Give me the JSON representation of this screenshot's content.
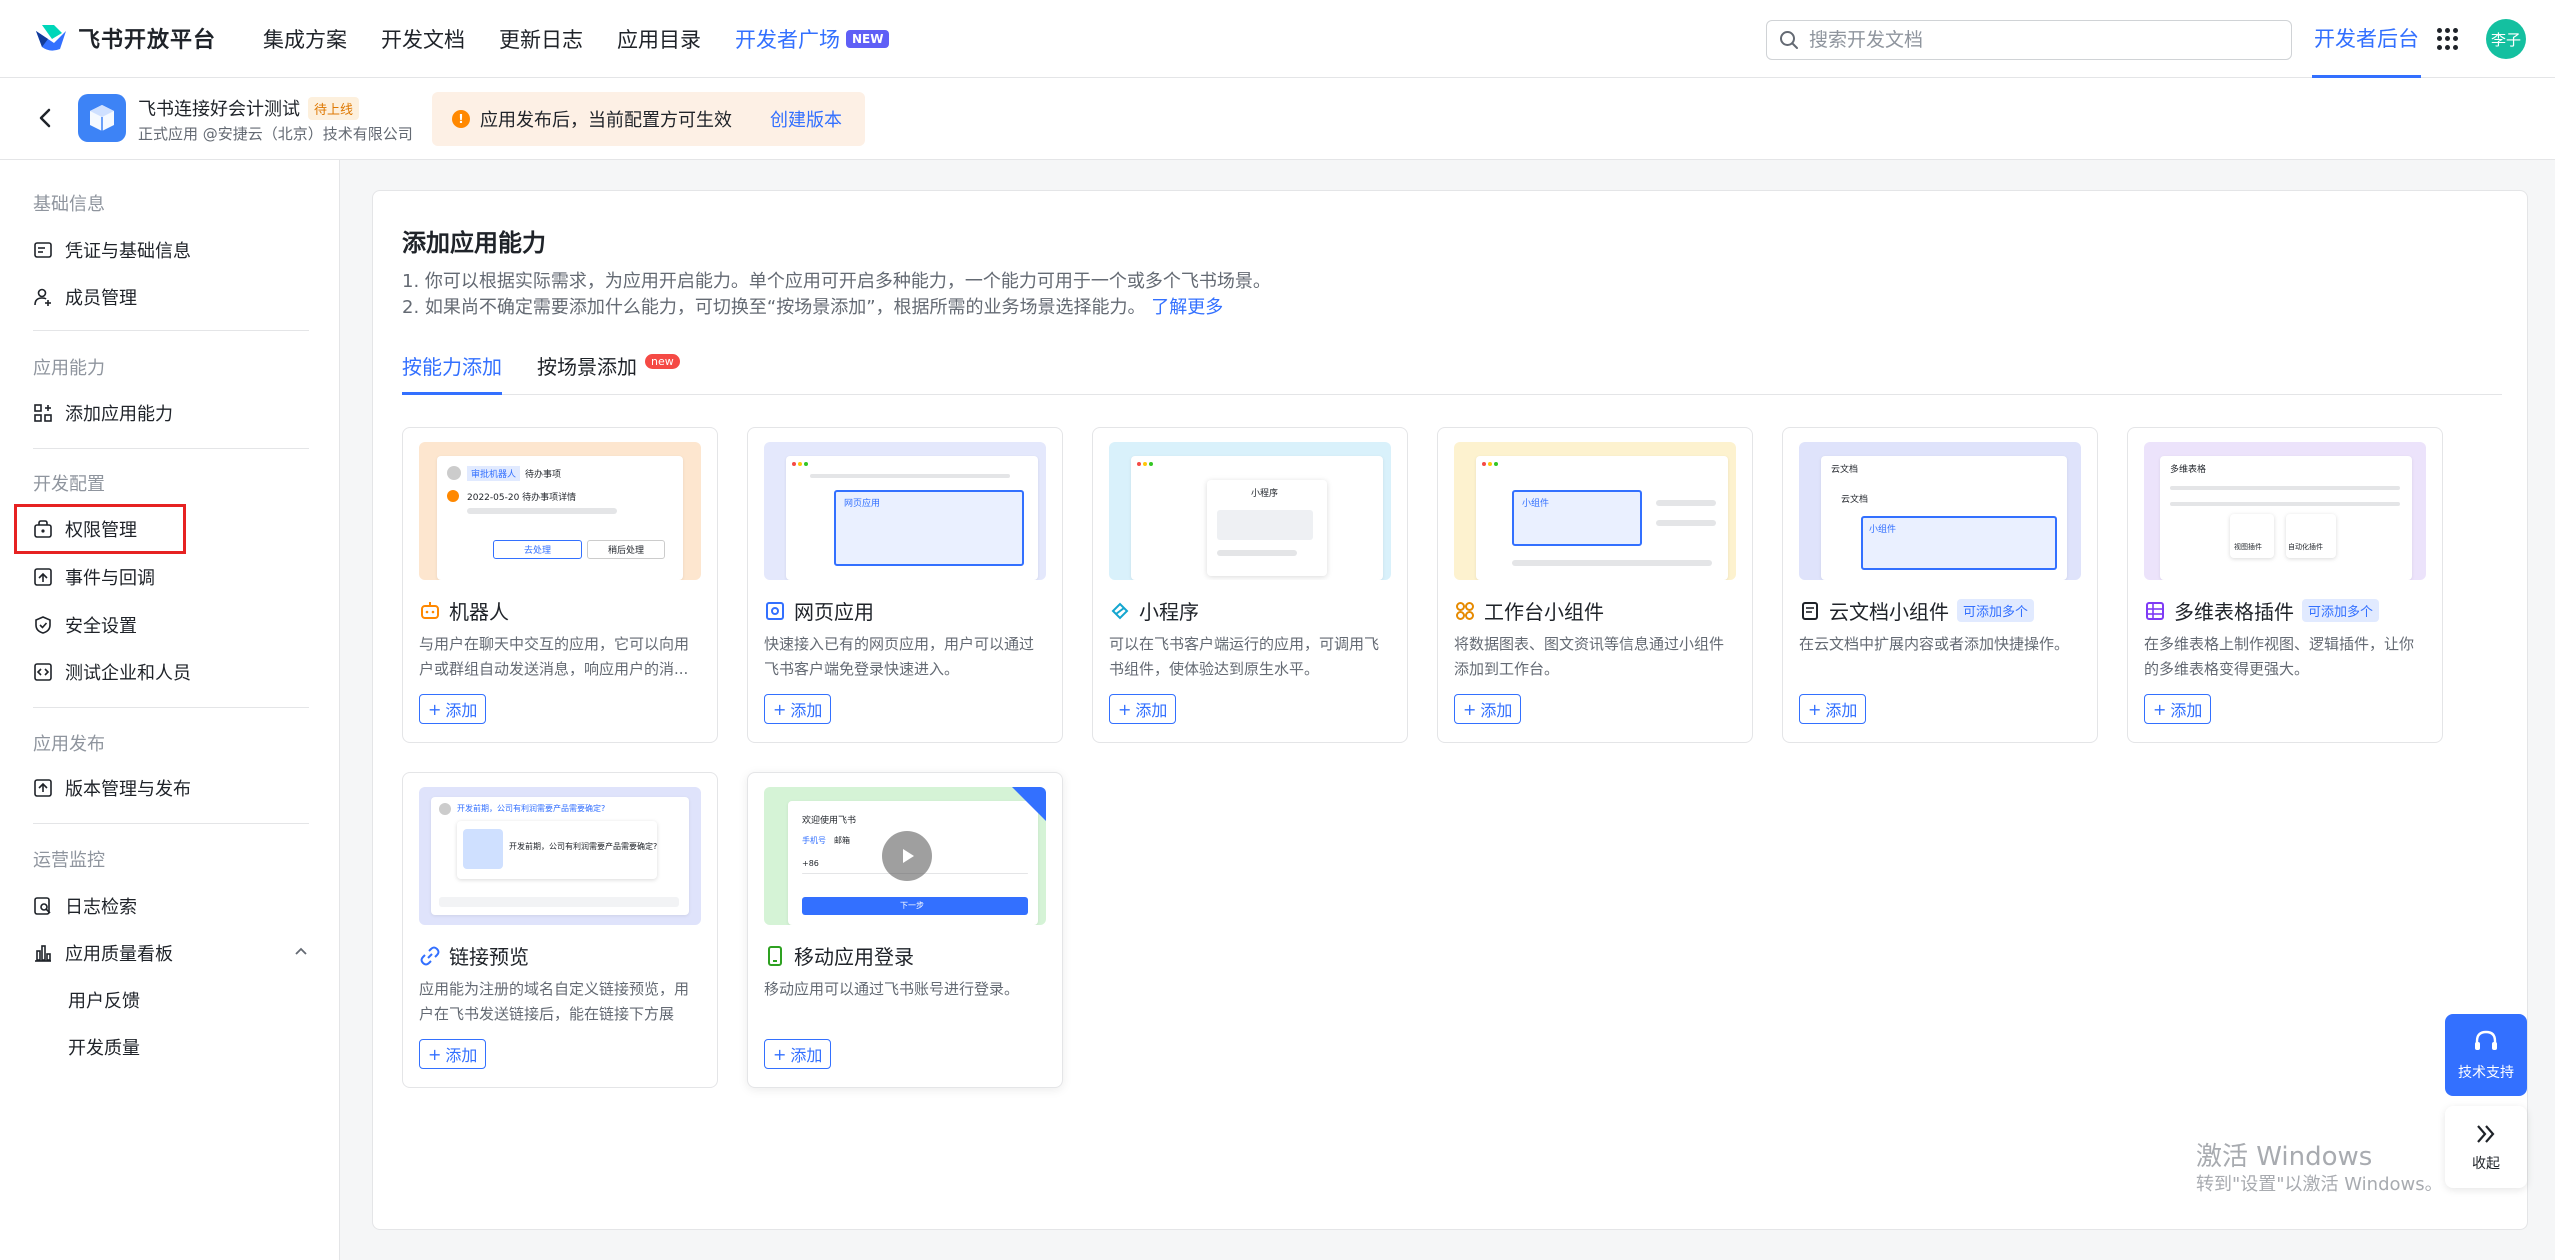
{
  "header": {
    "brand": "飞书开放平台",
    "nav": [
      "集成方案",
      "开发文档",
      "更新日志",
      "应用目录"
    ],
    "nav_accent": "开发者广场",
    "nav_accent_badge": "NEW",
    "search_placeholder": "搜索开发文档",
    "dev_console": "开发者后台",
    "avatar": "李子"
  },
  "app": {
    "name": "飞书连接好会计测试",
    "status": "待上线",
    "sub": "正式应用 @安捷云（北京）技术有限公司",
    "notice": "应用发布后，当前配置方可生效",
    "notice_link": "创建版本"
  },
  "sidebar": {
    "sections": {
      "basic": "基础信息",
      "capability": "应用能力",
      "dev_config": "开发配置",
      "publish": "应用发布",
      "ops": "运营监控"
    },
    "items": {
      "credentials": "凭证与基础信息",
      "members": "成员管理",
      "add_capability": "添加应用能力",
      "permissions": "权限管理",
      "events": "事件与回调",
      "security": "安全设置",
      "test_company": "测试企业和人员",
      "versions": "版本管理与发布",
      "logs": "日志检索",
      "quality": "应用质量看板",
      "feedback": "用户反馈",
      "dev_quality": "开发质量"
    }
  },
  "main": {
    "title": "添加应用能力",
    "desc1": "1. 你可以根据实际需求，为应用开启能力。单个应用可开启多种能力，一个能力可用于一个或多个飞书场景。",
    "desc2": "2. 如果尚不确定需要添加什么能力，可切换至“按场景添加”，根据所需的业务场景选择能力。",
    "desc2_link": "了解更多",
    "tabs": [
      "按能力添加",
      "按场景添加"
    ],
    "tab_badge": "new",
    "add_label": "添加",
    "cards": [
      {
        "title": "机器人",
        "desc": "与用户在聊天中交互的应用，它可以向用户或群组自动发送消息，响应用户的消..."
      },
      {
        "title": "网页应用",
        "desc": "快速接入已有的网页应用，用户可以通过飞书客户端免登录快速进入。"
      },
      {
        "title": "小程序",
        "desc": "可以在飞书客户端运行的应用，可调用飞书组件，使体验达到原生水平。"
      },
      {
        "title": "工作台小组件",
        "desc": "将数据图表、图文资讯等信息通过小组件添加到工作台。"
      },
      {
        "title": "云文档小组件",
        "tag": "可添加多个",
        "desc": "在云文档中扩展内容或者添加快捷操作。"
      },
      {
        "title": "多维表格插件",
        "tag": "可添加多个",
        "desc": "在多维表格上制作视图、逻辑插件，让你的多维表格变得更强大。"
      },
      {
        "title": "链接预览",
        "desc": "应用能为注册的域名自定义链接预览，用户在飞书发送链接后，能在链接下方展示..."
      },
      {
        "title": "移动应用登录",
        "desc": "移动应用可以通过飞书账号进行登录。"
      }
    ],
    "thumbs": {
      "robot_name": "审批机器人",
      "robot_msg": "待办事项",
      "robot_date": "2022-05-20 待办事项详情",
      "robot_btn1": "去处理",
      "robot_btn2": "稍后处理",
      "web_app": "网页应用",
      "mini": "小程序",
      "widget": "小组件",
      "doc_title": "云文档",
      "doc_sub": "云文档",
      "doc_widget": "小组件",
      "base_title": "多维表格",
      "base_plugin1": "视图插件",
      "base_plugin2": "自动化插件",
      "link_msg": "开发前期，公司有利润需要产品需要确定?",
      "link_msg2": "开发前期，公司有利润需要产品需要确定?",
      "mobile_title": "欢迎使用飞书",
      "mobile_tab1": "手机号",
      "mobile_tab2": "邮箱",
      "mobile_code": "+86",
      "mobile_next": "下一步"
    }
  },
  "float": {
    "support": "技术支持",
    "collapse": "收起"
  },
  "watermark": {
    "line1": "激活 Windows",
    "line2": "转到\"设置\"以激活 Windows。"
  },
  "colors": {
    "accent": "#3370ff",
    "warning": "#ff8800",
    "highlight": "#e62222"
  }
}
